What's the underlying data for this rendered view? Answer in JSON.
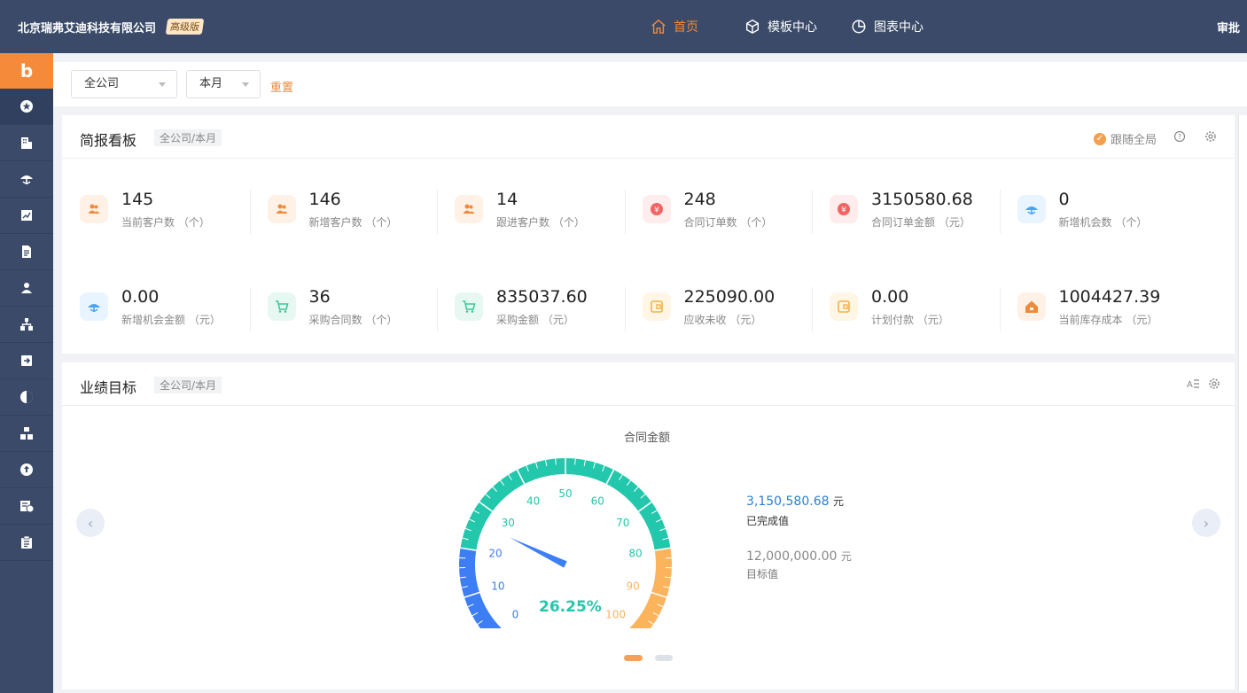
{
  "header": {
    "company": "北京瑞弗艾迪科技有限公司",
    "edition": "高级版",
    "nav": [
      {
        "label": "首页",
        "icon": "home-icon",
        "active": true
      },
      {
        "label": "模板中心",
        "icon": "cube-icon",
        "active": false
      },
      {
        "label": "图表中心",
        "icon": "pie-icon",
        "active": false
      }
    ],
    "approve": "审批"
  },
  "sidebar": {
    "logo": "b",
    "items": [
      "star-icon",
      "building-icon",
      "umbrella-icon",
      "chart-doc-icon",
      "document-icon",
      "user-card-icon",
      "org-icon",
      "export-icon",
      "pie-icon",
      "boxes-icon",
      "refresh-icon",
      "bill-icon",
      "clipboard-icon"
    ]
  },
  "filters": {
    "company": "全公司",
    "period": "本月",
    "reset": "重置"
  },
  "brief": {
    "title": "简报看板",
    "tag": "全公司/本月",
    "follow": "跟随全局",
    "stats": [
      {
        "value": "145",
        "label": "当前客户数 （个）",
        "icon": "users-icon",
        "color": "#f08a3a",
        "bg": "#fff1e6"
      },
      {
        "value": "146",
        "label": "新增客户数 （个）",
        "icon": "users-icon",
        "color": "#f08a3a",
        "bg": "#fff1e6"
      },
      {
        "value": "14",
        "label": "跟进客户数 （个）",
        "icon": "users-icon",
        "color": "#f08a3a",
        "bg": "#fff1e6"
      },
      {
        "value": "248",
        "label": "合同订单数 （个）",
        "icon": "yen-icon",
        "color": "#f26464",
        "bg": "#ffecec"
      },
      {
        "value": "3150580.68",
        "label": "合同订单金额 （元）",
        "icon": "yen-icon",
        "color": "#f26464",
        "bg": "#ffecec"
      },
      {
        "value": "0",
        "label": "新增机会数 （个）",
        "icon": "umbrella-icon",
        "color": "#4aa3f0",
        "bg": "#e8f4ff"
      },
      {
        "value": "0.00",
        "label": "新增机会金额 （元）",
        "icon": "umbrella-icon",
        "color": "#4aa3f0",
        "bg": "#e8f4ff"
      },
      {
        "value": "36",
        "label": "采购合同数 （个）",
        "icon": "cart-icon",
        "color": "#3cc99a",
        "bg": "#e6f8f1"
      },
      {
        "value": "835037.60",
        "label": "采购金额 （元）",
        "icon": "cart-icon",
        "color": "#3cc99a",
        "bg": "#e6f8f1"
      },
      {
        "value": "225090.00",
        "label": "应收未收 （元）",
        "icon": "wallet-icon",
        "color": "#f5b145",
        "bg": "#fff6e6"
      },
      {
        "value": "0.00",
        "label": "计划付款 （元）",
        "icon": "wallet-icon",
        "color": "#f5b145",
        "bg": "#fff6e6"
      },
      {
        "value": "1004427.39",
        "label": "当前库存成本 （元）",
        "icon": "house-icon",
        "color": "#f08a3a",
        "bg": "#fff1e6"
      }
    ]
  },
  "target": {
    "title": "业绩目标",
    "tag": "全公司/本月",
    "gauge_title": "合同金额",
    "percent": 26.25,
    "percent_label": "26.25%",
    "ticks": [
      "0",
      "10",
      "20",
      "30",
      "40",
      "50",
      "60",
      "70",
      "80",
      "90",
      "100"
    ],
    "completed_value": "3,150,580.68",
    "completed_unit": "元",
    "completed_label": "已完成值",
    "target_value": "12,000,000.00",
    "target_unit": "元",
    "target_label": "目标值",
    "colors": {
      "blue": "#3d7ef5",
      "teal": "#22c7ac",
      "orange": "#fbb45c"
    }
  }
}
